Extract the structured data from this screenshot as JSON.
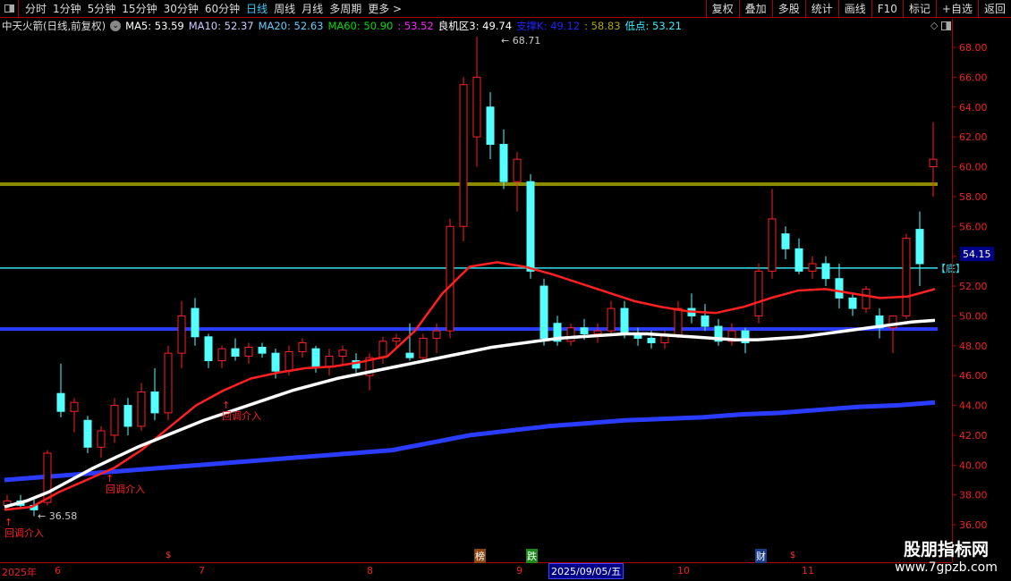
{
  "toolbar": {
    "periods": [
      "分时",
      "1分钟",
      "5分钟",
      "15分钟",
      "30分钟",
      "60分钟",
      "日线",
      "周线",
      "月线",
      "多周期",
      "更多 >"
    ],
    "active": "日线",
    "buttons": [
      "复权",
      "叠加",
      "多股",
      "统计",
      "画线",
      "F10",
      "标记",
      "+自选",
      "返回"
    ]
  },
  "info": {
    "name": "中天火箭(日线,前复权)",
    "ma5": "MA5: 53.59",
    "ma10": "MA10: 52.37",
    "ma20": "MA20: 52.63",
    "ma60": "MA60: 50.90",
    "extra": ": 53.52",
    "lj": "良机区3: 49.74",
    "zc": "支撑K: 49.12",
    "gold": ": 58.83",
    "low": "低点: 53.21"
  },
  "colors": {
    "up": "#ff2020",
    "down": "#54ffff",
    "ma5": "#ffffff",
    "ma10": "#ff2020",
    "ma60": "#2a3cff",
    "gold": "#8c8c00",
    "support": "#2a3cff",
    "lowline": "#33e0f0"
  },
  "chart_data": {
    "type": "candlestick",
    "ylim": [
      35,
      69
    ],
    "yticks": [
      "36.00",
      "38.00",
      "40.00",
      "42.00",
      "44.00",
      "46.00",
      "48.00",
      "50.00",
      "52.00",
      "54.00",
      "56.00",
      "58.00",
      "60.00",
      "62.00",
      "64.00",
      "66.00",
      "68.00"
    ],
    "candles": [
      [
        37.3,
        38.0,
        37.0,
        37.6
      ],
      [
        37.6,
        38.0,
        37.1,
        37.3
      ],
      [
        37.3,
        37.8,
        36.58,
        37.0
      ],
      [
        37.5,
        41.0,
        37.3,
        40.8
      ],
      [
        44.8,
        46.8,
        43.2,
        43.6
      ],
      [
        43.6,
        44.5,
        42.2,
        44.2
      ],
      [
        43.0,
        43.3,
        40.8,
        41.2
      ],
      [
        41.2,
        42.6,
        40.5,
        42.3
      ],
      [
        42.0,
        44.5,
        41.5,
        44.0
      ],
      [
        44.0,
        44.5,
        42.0,
        42.6
      ],
      [
        42.6,
        45.5,
        42.3,
        44.9
      ],
      [
        44.9,
        46.5,
        43.0,
        43.5
      ],
      [
        43.5,
        48.0,
        43.0,
        47.5
      ],
      [
        47.5,
        51.0,
        46.5,
        50.0
      ],
      [
        50.5,
        51.2,
        48.0,
        48.6
      ],
      [
        48.6,
        48.8,
        46.5,
        47.0
      ],
      [
        47.0,
        48.0,
        46.5,
        47.8
      ],
      [
        47.8,
        48.5,
        47.0,
        47.3
      ],
      [
        47.3,
        48.2,
        46.8,
        47.9
      ],
      [
        47.9,
        48.2,
        47.2,
        47.5
      ],
      [
        47.5,
        47.8,
        45.8,
        46.3
      ],
      [
        46.3,
        48.0,
        46.0,
        47.6
      ],
      [
        47.6,
        48.5,
        47.2,
        48.2
      ],
      [
        47.8,
        48.0,
        46.2,
        46.6
      ],
      [
        46.6,
        47.8,
        46.0,
        47.3
      ],
      [
        47.3,
        48.0,
        46.8,
        47.7
      ],
      [
        47.0,
        47.5,
        46.2,
        46.5
      ],
      [
        46.0,
        47.5,
        45.0,
        47.2
      ],
      [
        47.2,
        48.6,
        46.8,
        48.3
      ],
      [
        48.3,
        48.8,
        47.8,
        48.5
      ],
      [
        47.5,
        49.5,
        47.0,
        47.2
      ],
      [
        47.2,
        48.8,
        47.0,
        48.5
      ],
      [
        48.5,
        49.5,
        47.5,
        49.0
      ],
      [
        49.0,
        56.5,
        48.5,
        56.0
      ],
      [
        56.0,
        66.0,
        55.0,
        65.5
      ],
      [
        62.0,
        68.71,
        60.0,
        66.0
      ],
      [
        64.0,
        65.0,
        60.5,
        61.5
      ],
      [
        61.5,
        62.5,
        58.5,
        59.0
      ],
      [
        59.0,
        61.0,
        57.0,
        60.5
      ],
      [
        59.0,
        59.5,
        52.5,
        53.0
      ],
      [
        52.0,
        52.5,
        48.0,
        48.5
      ],
      [
        49.5,
        50.0,
        48.0,
        48.3
      ],
      [
        48.3,
        49.5,
        48.0,
        49.2
      ],
      [
        49.2,
        49.8,
        48.4,
        48.8
      ],
      [
        48.8,
        49.5,
        48.2,
        49.0
      ],
      [
        49.0,
        51.0,
        48.8,
        50.5
      ],
      [
        50.5,
        51.0,
        48.5,
        48.8
      ],
      [
        48.8,
        49.2,
        48.0,
        48.5
      ],
      [
        48.5,
        49.0,
        47.8,
        48.2
      ],
      [
        48.2,
        49.0,
        47.8,
        48.7
      ],
      [
        48.7,
        51.0,
        48.5,
        50.5
      ],
      [
        50.5,
        51.5,
        49.5,
        50.0
      ],
      [
        50.0,
        50.8,
        49.0,
        49.3
      ],
      [
        49.3,
        49.8,
        48.0,
        48.3
      ],
      [
        48.3,
        49.5,
        48.0,
        49.0
      ],
      [
        49.0,
        49.2,
        47.5,
        48.2
      ],
      [
        50.0,
        53.5,
        49.5,
        53.0
      ],
      [
        53.0,
        58.5,
        52.5,
        56.5
      ],
      [
        55.5,
        56.0,
        53.8,
        54.5
      ],
      [
        54.5,
        55.2,
        52.8,
        53.0
      ],
      [
        53.0,
        54.0,
        52.5,
        53.5
      ],
      [
        53.5,
        54.0,
        52.0,
        52.5
      ],
      [
        52.5,
        53.5,
        50.5,
        51.2
      ],
      [
        51.2,
        51.5,
        50.0,
        50.5
      ],
      [
        50.5,
        52.0,
        50.2,
        51.8
      ],
      [
        50.0,
        50.5,
        48.5,
        49.2
      ],
      [
        49.2,
        50.0,
        47.5,
        50.0
      ],
      [
        50.0,
        55.5,
        49.8,
        55.2
      ],
      [
        55.8,
        57.0,
        52.0,
        53.5
      ],
      [
        60.0,
        63.0,
        58.0,
        60.5
      ]
    ],
    "ma_white": [
      37.2,
      37.6,
      38.2,
      39.0,
      39.8,
      40.5,
      41.2,
      41.8,
      42.4,
      43.0,
      43.5,
      44.0,
      44.5,
      45.0,
      45.4,
      45.8,
      46.1,
      46.4,
      46.7,
      47.0,
      47.3,
      47.6,
      47.9,
      48.1,
      48.3,
      48.5,
      48.6,
      48.7,
      48.8,
      48.8,
      48.7,
      48.6,
      48.5,
      48.4,
      48.4,
      48.5,
      48.6,
      48.8,
      49.0,
      49.2,
      49.4,
      49.6,
      49.7
    ],
    "ma_red": [
      37.0,
      37.2,
      38.2,
      39.0,
      39.8,
      41.0,
      42.5,
      44.0,
      45.0,
      45.8,
      46.2,
      46.5,
      46.6,
      46.9,
      47.3,
      49.0,
      51.5,
      53.3,
      53.6,
      53.3,
      52.8,
      52.2,
      51.6,
      51.0,
      50.6,
      50.3,
      50.2,
      50.6,
      51.2,
      51.7,
      51.8,
      51.5,
      51.2,
      51.3,
      51.8
    ],
    "ma60": [
      39.0,
      39.2,
      39.4,
      39.6,
      39.8,
      40.0,
      40.2,
      40.4,
      40.6,
      40.8,
      41.0,
      41.5,
      42.0,
      42.3,
      42.6,
      42.8,
      43.0,
      43.1,
      43.2,
      43.4,
      43.5,
      43.7,
      43.9,
      44.0,
      44.2
    ],
    "hlines": {
      "gold": 58.83,
      "support": 49.12,
      "low": 53.21
    },
    "high_label": "68.71",
    "low_label": "36.58",
    "current": "54.15",
    "bottom_tag": "【底】",
    "signals": [
      "回调介入",
      "回调介入",
      "回调介入"
    ]
  },
  "timeline": {
    "labels": [
      "2025年",
      "6",
      "7",
      "8",
      "9",
      "10",
      "11"
    ],
    "date": "2025/09/05/五",
    "tags": [
      "榜",
      "跌",
      "财"
    ],
    "s": "$"
  },
  "watermark": {
    "line1": "股朋指标网",
    "line2": "www.7gpzb.com"
  }
}
